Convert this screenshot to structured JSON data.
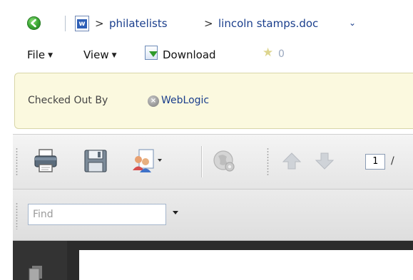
{
  "breadcrumb": {
    "separator": ">",
    "folder": "philatelists",
    "document": "lincoln stamps.doc",
    "dropdown_glyph": "⌄"
  },
  "menu": {
    "file_label": "File",
    "view_label": "View",
    "download_label": "Download",
    "rating_count": "0"
  },
  "checkout": {
    "label": "Checked Out By",
    "user": "WebLogic"
  },
  "viewer_toolbar": {
    "page_number": "1",
    "page_suffix": "/"
  },
  "find": {
    "placeholder": "Find"
  },
  "icons": {
    "back": "back-arrow-icon",
    "document": "word-document-icon",
    "download": "download-icon",
    "star": "star-icon",
    "remove": "remove-circle-icon",
    "print": "printer-icon",
    "save": "floppy-disk-icon",
    "share": "users-document-icon",
    "search_settings": "globe-gear-icon",
    "previous": "arrow-up-icon",
    "next": "arrow-down-icon",
    "pages": "pages-icon"
  },
  "colors": {
    "link": "#1a3e8c",
    "banner_bg": "#fbf9df",
    "back_green": "#3da936",
    "doc_dark": "#2b2b2b"
  }
}
